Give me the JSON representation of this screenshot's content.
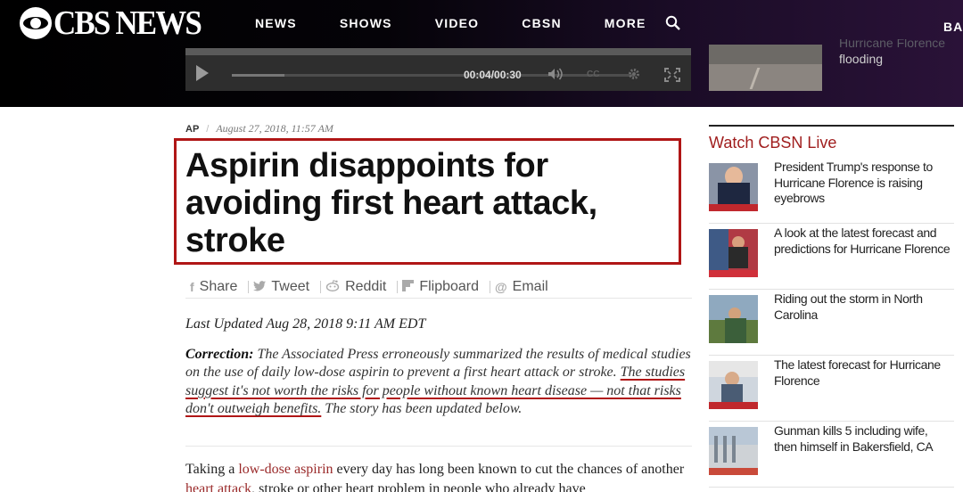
{
  "header": {
    "logo_text": "CBS NEWS",
    "nav": [
      "NEWS",
      "SHOWS",
      "VIDEO",
      "CBSN",
      "MORE"
    ],
    "nav_cut_text": "BA"
  },
  "video": {
    "time": "00:04/00:30",
    "progress": 0.13,
    "cc_label": "CC"
  },
  "top_right_teaser": {
    "faded_text": "Hurricane Florence",
    "text": "flooding"
  },
  "article": {
    "source": "AP",
    "date": "August 27, 2018, 11:57 AM",
    "headline": "Aspirin disappoints for avoiding first heart attack, stroke",
    "share": [
      {
        "icon": "f",
        "name": "facebook-icon",
        "label": "Share"
      },
      {
        "icon": "❤",
        "name": "twitter-icon",
        "label": "Tweet"
      },
      {
        "icon": "☺",
        "name": "reddit-icon",
        "label": "Reddit"
      },
      {
        "icon": "F",
        "name": "flipboard-icon",
        "label": "Flipboard"
      },
      {
        "icon": "@",
        "name": "email-icon",
        "label": "Email"
      }
    ],
    "updated": "Last Updated Aug 28, 2018 9:11 AM EDT",
    "correction_label": "Correction:",
    "correction_text_1": " The Associated Press erroneously summarized the results of medical studies on the use of daily low-dose aspirin to prevent a first heart attack or stroke. ",
    "correction_highlight": "The studies suggest it's not worth the risks for people without known heart disease — not that risks don't outweigh benefits.",
    "correction_text_2": " The story has been updated below.",
    "body_1": "Taking a ",
    "body_link_1": "low-dose aspirin",
    "body_2": " every day has long been known to cut the chances of another ",
    "body_link_2": "heart attack",
    "body_3": ", stroke or other heart problem in people who already have"
  },
  "sidebar": {
    "title": "Watch CBSN Live",
    "items": [
      {
        "text": "President Trump's response to Hurricane Florence is raising eyebrows"
      },
      {
        "text": "A look at the latest forecast and predictions for Hurricane Florence"
      },
      {
        "text": "Riding out the storm in North Carolina"
      },
      {
        "text": "The latest forecast for Hurricane Florence"
      },
      {
        "text": "Gunman kills 5 including wife, then himself in Bakersfield, CA"
      }
    ]
  },
  "colors": {
    "brand_red": "#b01616",
    "link": "#9a2a2a",
    "sidebar_title": "#a01e1e"
  }
}
